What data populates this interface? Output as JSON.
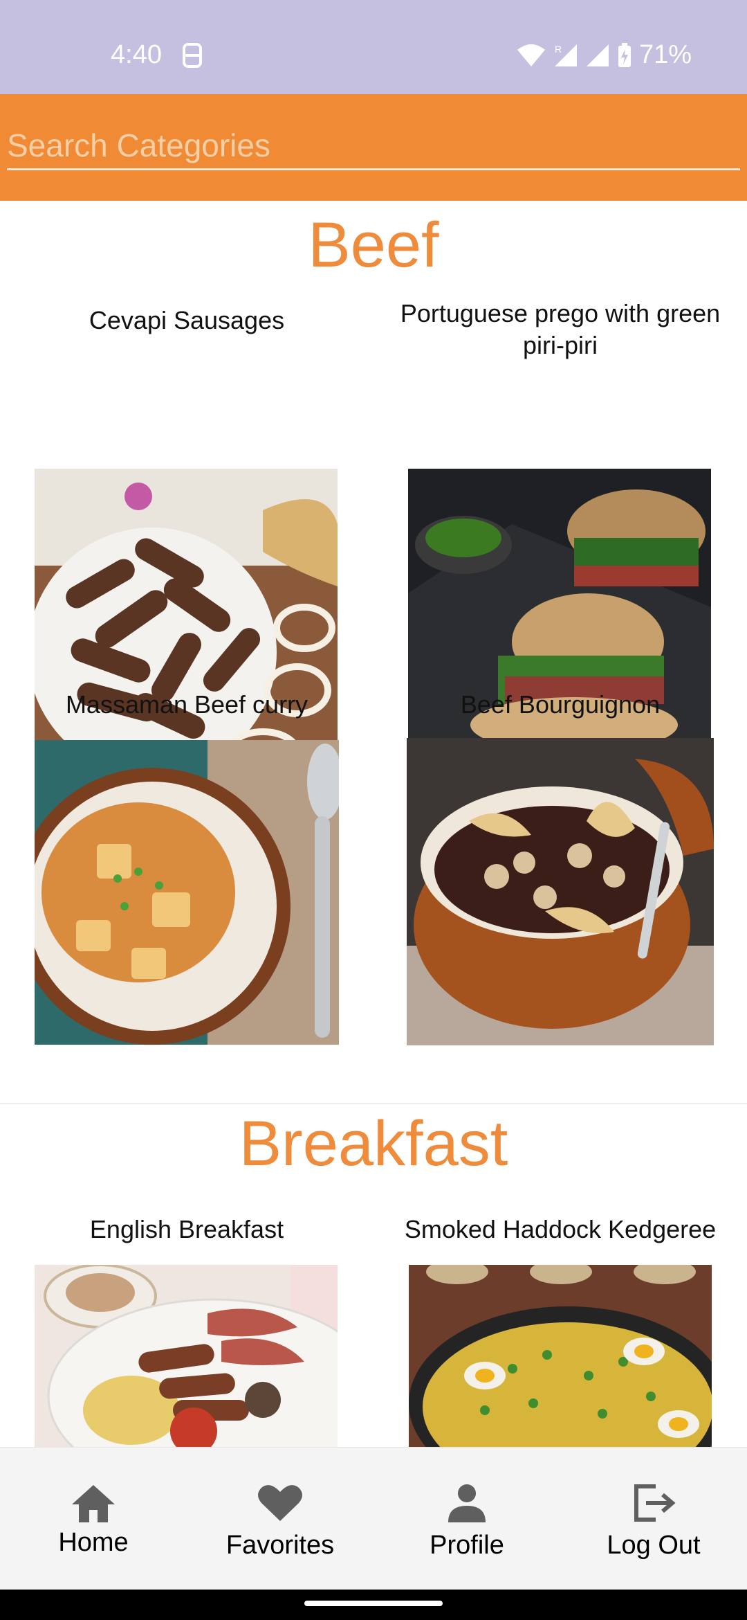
{
  "status_bar": {
    "time": "4:40",
    "battery": "71%",
    "icons": [
      "sim-icon",
      "wifi-icon",
      "roaming-signal-icon",
      "signal-icon",
      "battery-charging-icon"
    ]
  },
  "search": {
    "placeholder": "Search Categories",
    "value": ""
  },
  "categories": [
    {
      "title": "Beef",
      "meals": [
        {
          "name": "Cevapi Sausages",
          "image": "cevapi-sausages-photo"
        },
        {
          "name": "Portuguese prego with green piri-piri",
          "image": "portuguese-prego-photo"
        },
        {
          "name": "Massaman Beef curry",
          "image": "massaman-curry-photo"
        },
        {
          "name": "Beef Bourguignon",
          "image": "beef-bourguignon-photo"
        }
      ]
    },
    {
      "title": "Breakfast",
      "meals": [
        {
          "name": "English Breakfast",
          "image": "english-breakfast-photo"
        },
        {
          "name": "Smoked Haddock Kedgeree",
          "image": "kedgeree-photo"
        }
      ]
    }
  ],
  "bottom_nav": [
    {
      "label": "Home",
      "icon": "home-icon"
    },
    {
      "label": "Favorites",
      "icon": "heart-icon"
    },
    {
      "label": "Profile",
      "icon": "person-icon"
    },
    {
      "label": "Log Out",
      "icon": "logout-icon"
    }
  ],
  "colors": {
    "status_bar": "#c5bfe0",
    "accent": "#f08a35",
    "title": "#ef8c3c"
  }
}
